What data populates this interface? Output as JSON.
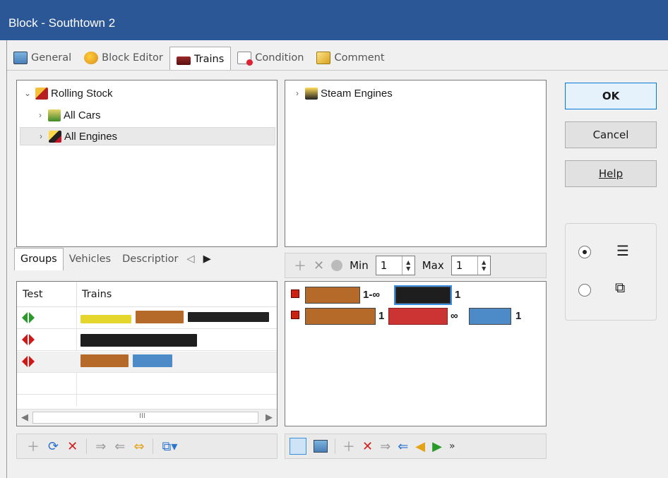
{
  "window": {
    "title": "Block - Southtown 2"
  },
  "tabs": [
    {
      "label": "General",
      "icon": "general-icon"
    },
    {
      "label": "Block Editor",
      "icon": "block-editor-icon"
    },
    {
      "label": "Trains",
      "icon": "trains-icon",
      "active": true
    },
    {
      "label": "Condition",
      "icon": "condition-icon"
    },
    {
      "label": "Comment",
      "icon": "comment-icon"
    }
  ],
  "tree_left": {
    "items": [
      {
        "label": "Rolling Stock",
        "expanded": true
      },
      {
        "label": "All Cars"
      },
      {
        "label": "All Engines",
        "selected": true
      }
    ]
  },
  "tree_right": {
    "items": [
      {
        "label": "Steam Engines"
      }
    ]
  },
  "subtabs": [
    {
      "label": "Groups",
      "active": true
    },
    {
      "label": "Vehicles"
    },
    {
      "label": "Descriptior"
    }
  ],
  "grid": {
    "columns": [
      "Test",
      "Trains"
    ],
    "rows": [
      {
        "test_color": "#2a9a2a"
      },
      {
        "test_color": "#d01818"
      },
      {
        "test_color": "#d01818"
      }
    ]
  },
  "min_max": {
    "min_label": "Min",
    "min_value": "1",
    "max_label": "Max",
    "max_value": "1"
  },
  "sequence": {
    "row1": [
      "1-∞",
      "1"
    ],
    "row2": [
      "1",
      "∞",
      "1"
    ]
  },
  "buttons": {
    "ok": "OK",
    "cancel": "Cancel",
    "help": "Help"
  },
  "scroll_glyph": "III",
  "overflow_glyph": "»"
}
